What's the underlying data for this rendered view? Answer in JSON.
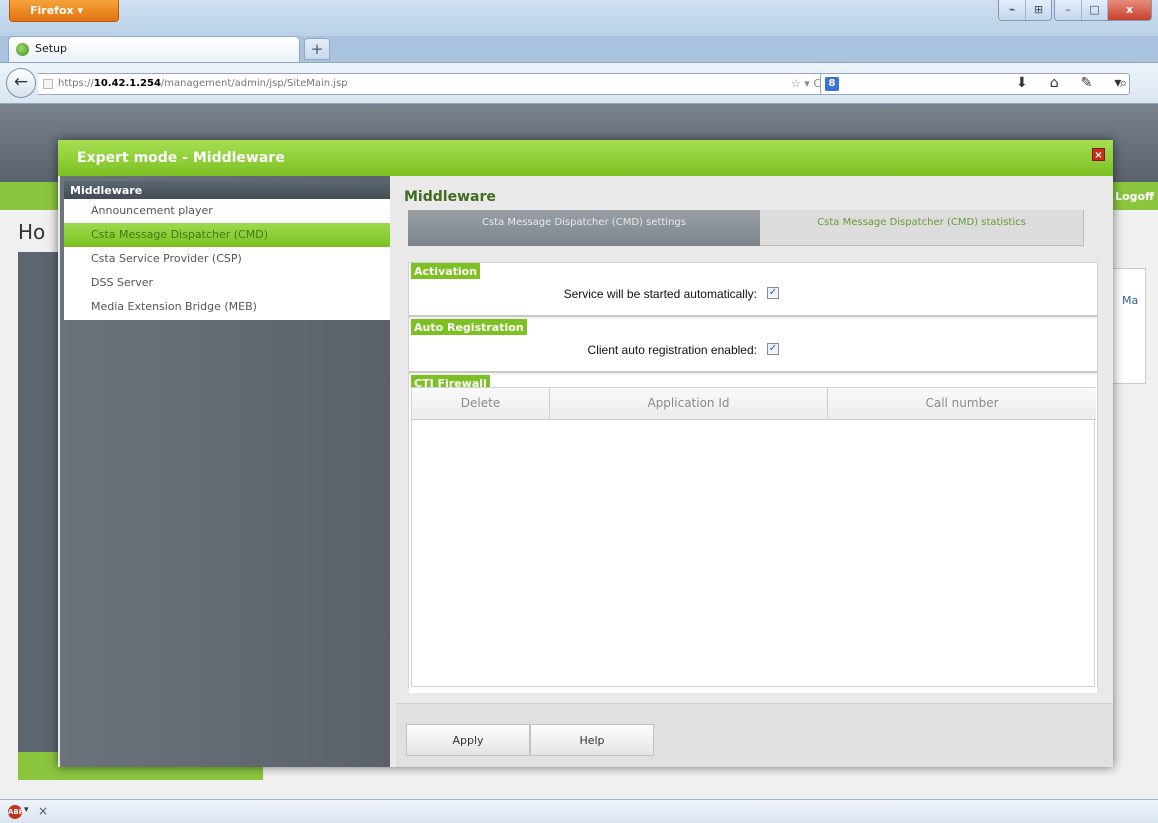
{
  "browser": {
    "menu_button": "Firefox",
    "tab_title": "Setup",
    "new_tab": "+",
    "url_prefix": "https://",
    "url_host": "10.42.1.254",
    "url_path": "/management/admin/jsp/SiteMain.jsp",
    "search_engine": "8",
    "window_controls": [
      "⌁",
      "⊞",
      "–",
      "□",
      "x"
    ]
  },
  "background_app": {
    "logoff": "Logoff",
    "home_title": "Ho",
    "link": "Ma"
  },
  "dialog": {
    "title": "Expert mode - Middleware",
    "close_glyph": "×",
    "sidebar": {
      "header": "Middleware",
      "items": [
        {
          "label": "Announcement player",
          "active": false
        },
        {
          "label": "Csta Message Dispatcher (CMD)",
          "active": true
        },
        {
          "label": "Csta Service Provider (CSP)",
          "active": false
        },
        {
          "label": "DSS Server",
          "active": false
        },
        {
          "label": "Media Extension Bridge (MEB)",
          "active": false
        }
      ]
    },
    "content": {
      "title": "Middleware",
      "tabs": [
        {
          "label": "Csta Message Dispatcher (CMD) settings",
          "active": true
        },
        {
          "label": "Csta Message Dispatcher (CMD) statistics",
          "active": false
        }
      ],
      "sections": {
        "activation": {
          "label": "Activation",
          "field_label": "Service will be started automatically:",
          "checked": true
        },
        "auto_registration": {
          "label": "Auto Registration",
          "field_label": "Client auto registration enabled:",
          "checked": true
        },
        "cti_firewall": {
          "label": "CTI Firewall",
          "columns": [
            "Delete",
            "Application Id",
            "Call number"
          ],
          "rows": []
        }
      },
      "buttons": {
        "apply": "Apply",
        "help": "Help"
      }
    }
  },
  "colors": {
    "accent_green": "#7cc121",
    "header_green": "#a6df53",
    "sidebar_gray": "#5a6169",
    "close_red": "#c92d1b"
  }
}
